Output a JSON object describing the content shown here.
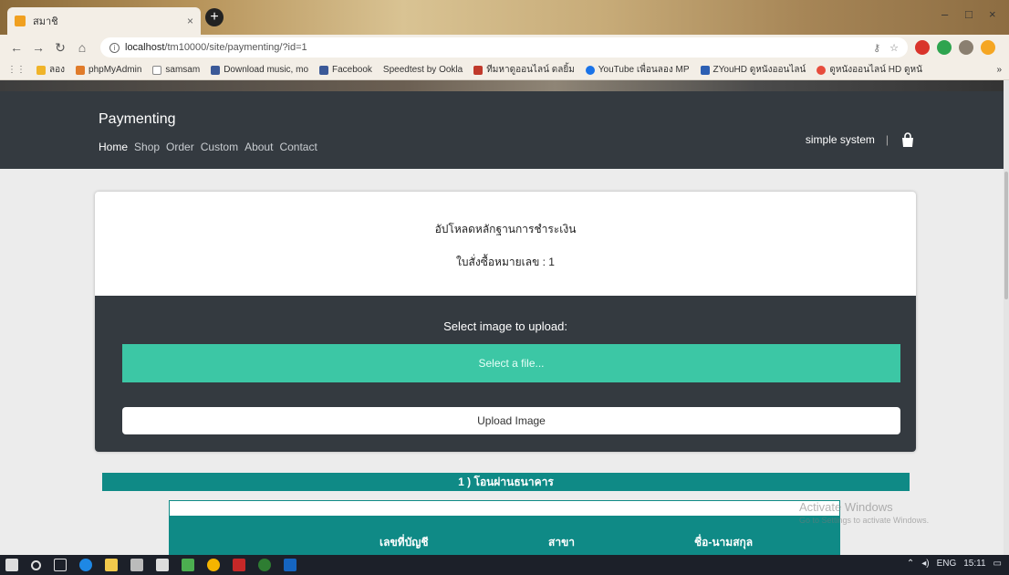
{
  "browser": {
    "tab_title": "สมาชิ",
    "tab_close": "×",
    "new_tab": "+",
    "url_host": "localhost",
    "url_path": "/tm10000/site/paymenting/?id=1",
    "info_icon": "i",
    "window_controls": [
      "–",
      "□",
      "×"
    ],
    "bookmarks": [
      {
        "label": "ลอง",
        "color": "#f0b429"
      },
      {
        "label": "phpMyAdmin",
        "color": "#e07b2a"
      },
      {
        "label": "samsam",
        "color": "#ffffff"
      },
      {
        "label": "Download music, mo",
        "color": "#3b5998"
      },
      {
        "label": "Facebook",
        "color": "#3b5998"
      },
      {
        "label": "Speedtest by Ookla",
        "color": "#222222"
      },
      {
        "label": "ทีมหาดูออนไลน์ ดลยิ้ม",
        "color": "#c0392b"
      },
      {
        "label": "YouTube เพื่อนลอง MP",
        "color": "#1a73e8"
      },
      {
        "label": "ZYouHD ดูหนังออนไลน์",
        "color": "#2d5fb3"
      },
      {
        "label": "ดูหนังออนไลน์ HD ดูหนั",
        "color": "#e74c3c"
      }
    ],
    "more": "»"
  },
  "site": {
    "brand": "Paymenting",
    "nav": [
      "Home",
      "Shop",
      "Order",
      "Custom",
      "About",
      "Contact"
    ],
    "user_label": "simple system",
    "separator": "|"
  },
  "card": {
    "title": "อัปโหลดหลักฐานการชำระเงิน",
    "order_label": "ใบสั่งซื้อหมายเลข : 1",
    "upload_label": "Select image to upload:",
    "select_file": "Select a file...",
    "upload_button": "Upload Image"
  },
  "bank": {
    "header": "1 ) โอนผ่านธนาคาร",
    "columns": [
      "เลขที่บัญชี",
      "สาขา",
      "ชื่อ-นามสกุล"
    ]
  },
  "watermark": {
    "line1": "Activate Windows",
    "line2": "Go to Settings to activate Windows."
  },
  "taskbar": {
    "tray": [
      "ENG",
      "15:11"
    ]
  },
  "colors": {
    "header_bg": "#343a40",
    "accent_green": "#3cc7a5",
    "teal": "#0f8a86"
  }
}
